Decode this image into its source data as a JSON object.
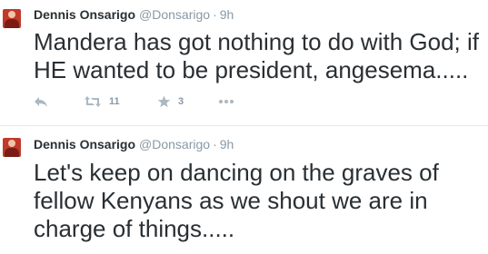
{
  "tweets": [
    {
      "name": "Dennis Onsarigo",
      "handle": "@Donsarigo",
      "separator": "·",
      "time": "9h",
      "text": "Mandera has got nothing to do with God; if HE wanted to be president, angesema.....",
      "actions": {
        "reply_icon": "reply-icon",
        "retweet_icon": "retweet-icon",
        "retweet_count": "11",
        "favorite_icon": "star-icon",
        "favorite_count": "3",
        "more_icon": "more-icon"
      }
    },
    {
      "name": "Dennis Onsarigo",
      "handle": "@Donsarigo",
      "separator": "·",
      "time": "9h",
      "text": "Let's keep on dancing on the graves of fellow Kenyans as we shout we are in charge of things....."
    }
  ],
  "colors": {
    "text": "#292f33",
    "secondary": "#8899a6",
    "icon": "#aab8c2",
    "divider": "#e1e8ed",
    "avatar": "#c0392b"
  }
}
